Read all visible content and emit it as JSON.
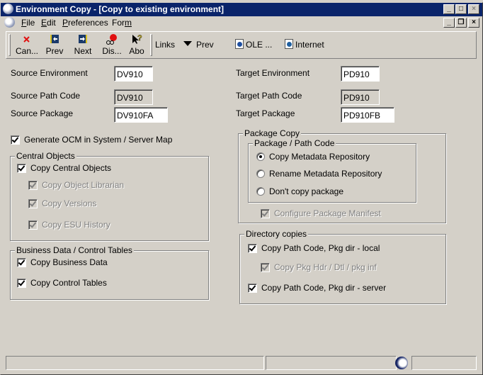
{
  "window": {
    "title": "Environment Copy - [Copy to existing environment]",
    "controls": {
      "minimize": "_",
      "maximize": "□",
      "close": "×"
    },
    "mdi_controls": {
      "minimize": "_",
      "restore": "❐",
      "close": "×"
    }
  },
  "menubar": {
    "items": [
      {
        "label": "File",
        "accel": "F"
      },
      {
        "label": "Edit",
        "accel": "E"
      },
      {
        "label": "Preferences",
        "accel": "P"
      },
      {
        "label": "Form",
        "accel": "m"
      }
    ]
  },
  "toolbar": {
    "buttons": [
      {
        "label": "Can...",
        "icon": "cancel-x-icon"
      },
      {
        "label": "Prev",
        "icon": "prev-record-icon"
      },
      {
        "label": "Next",
        "icon": "next-record-icon"
      },
      {
        "label": "Dis...",
        "icon": "display-errors-icon"
      },
      {
        "label": "Abo",
        "icon": "about-help-icon"
      }
    ],
    "links_label": "Links",
    "prev_label": "Prev",
    "ole_label": "OLE ...",
    "internet_label": "Internet"
  },
  "form": {
    "source_environment": {
      "label": "Source Environment",
      "value": "DV910"
    },
    "source_path_code": {
      "label": "Source Path Code",
      "value": "DV910"
    },
    "source_package": {
      "label": "Source Package",
      "value": "DV910FA"
    },
    "target_environment": {
      "label": "Target Environment",
      "value": "PD910"
    },
    "target_path_code": {
      "label": "Target Path Code",
      "value": "PD910"
    },
    "target_package": {
      "label": "Target Package",
      "value": "PD910FB"
    },
    "generate_ocm": {
      "label": "Generate OCM in System / Server Map",
      "checked": true
    }
  },
  "central_objects": {
    "title": "Central Objects",
    "copy_central_objects": {
      "label": "Copy Central Objects",
      "checked": true
    },
    "copy_object_librarian": {
      "label": "Copy Object Librarian",
      "checked": true,
      "disabled": true
    },
    "copy_versions": {
      "label": "Copy Versions",
      "checked": true,
      "disabled": true
    },
    "copy_esu_history": {
      "label": "Copy ESU History",
      "checked": true,
      "disabled": true
    }
  },
  "business_data": {
    "title": "Business Data / Control Tables",
    "copy_business_data": {
      "label": "Copy Business Data",
      "checked": true
    },
    "copy_control_tables": {
      "label": "Copy Control Tables",
      "checked": true
    }
  },
  "package_copy": {
    "title": "Package Copy",
    "path_code_group_title": "Package / Path Code",
    "options": [
      {
        "label": "Copy Metadata Repository",
        "selected": true
      },
      {
        "label": "Rename Metadata Repository",
        "selected": false
      },
      {
        "label": "Don't copy package",
        "selected": false
      }
    ],
    "configure_manifest": {
      "label": "Configure Package Manifest",
      "checked": true,
      "disabled": true
    }
  },
  "directory_copies": {
    "title": "Directory copies",
    "copy_local": {
      "label": "Copy Path Code, Pkg dir - local",
      "checked": true
    },
    "copy_pkg_hdr": {
      "label": "Copy Pkg Hdr / Dtl / pkg inf",
      "checked": true,
      "disabled": true
    },
    "copy_server": {
      "label": "Copy Path Code, Pkg dir - server",
      "checked": true
    }
  }
}
